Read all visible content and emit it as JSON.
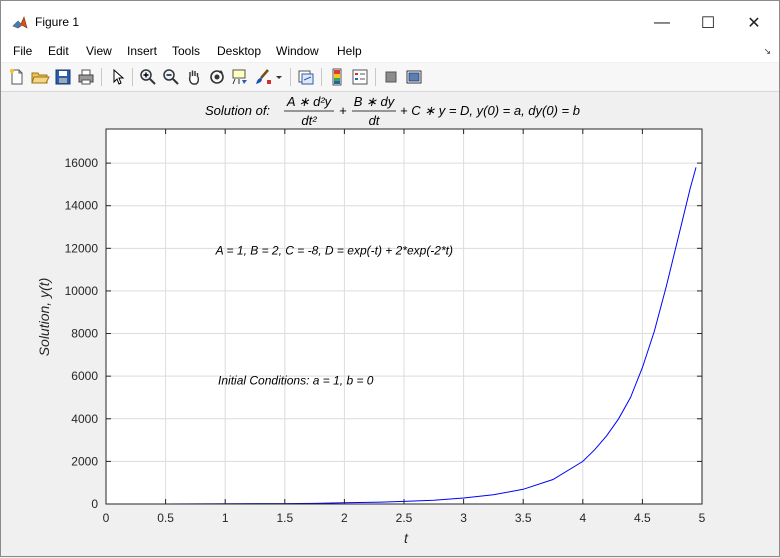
{
  "window": {
    "title": "Figure 1",
    "minimize_glyph": "—",
    "maximize_glyph": "☐",
    "close_glyph": "✕"
  },
  "menu": {
    "items": [
      "File",
      "Edit",
      "View",
      "Insert",
      "Tools",
      "Desktop",
      "Window",
      "Help"
    ],
    "overflow_glyph": "↘"
  },
  "toolbar": {
    "icons": [
      "new-figure-icon",
      "open-file-icon",
      "save-icon",
      "print-icon",
      "pointer-icon",
      "zoom-in-icon",
      "zoom-out-icon",
      "pan-hand-icon",
      "rotate-3d-icon",
      "data-cursor-icon",
      "brush-icon",
      "dropdown-arrow-icon",
      "link-plot-icon",
      "colorbar-icon",
      "legend-icon",
      "hide-plot-tools-icon",
      "show-plot-tools-icon"
    ]
  },
  "colors": {
    "series_line": "#0000ff",
    "grid": "#dcdcdc",
    "axes": "#262626",
    "menu_bg": "#ffffff",
    "figure_bg": "#f0f0f0"
  },
  "chart_data": {
    "type": "line",
    "title_prefix": "Solution of:",
    "title": "A*d²y/dt² + B*dy/dt + C*y = D, y(0) = a, dy(0) = b",
    "title_parts": {
      "frac1_num": "A ∗ d²y",
      "frac1_den": "dt²",
      "plus": "+",
      "frac2_num": "B ∗ dy",
      "frac2_den": "dt",
      "tail": "+ C ∗ y = D, y(0) = a, dy(0) = b"
    },
    "xlabel": "t",
    "ylabel": "Solution, y(t)",
    "xlim": [
      0,
      5
    ],
    "ylim": [
      0,
      17600
    ],
    "xticks": [
      0,
      0.5,
      1,
      1.5,
      2,
      2.5,
      3,
      3.5,
      4,
      4.5,
      5
    ],
    "xtick_labels": [
      "0",
      "0.5",
      "1",
      "1.5",
      "2",
      "2.5",
      "3",
      "3.5",
      "4",
      "4.5",
      "5"
    ],
    "yticks": [
      0,
      2000,
      4000,
      6000,
      8000,
      10000,
      12000,
      14000,
      16000
    ],
    "ytick_labels": [
      "0",
      "2000",
      "4000",
      "6000",
      "8000",
      "10000",
      "12000",
      "14000",
      "16000"
    ],
    "grid": true,
    "annotations": [
      {
        "text": "A = 1, B = 2, C = -8, D = exp(-t) + 2*exp(-2*t)",
        "x": 0.92,
        "y": 11700
      },
      {
        "text": "Initial Conditions: a = 1, b = 0",
        "x": 0.94,
        "y": 5600
      }
    ],
    "series": [
      {
        "x": [
          0,
          0.25,
          0.5,
          0.75,
          1.0,
          1.25,
          1.5,
          1.75,
          2.0,
          2.25,
          2.5,
          2.75,
          3.0,
          3.25,
          3.5,
          3.75,
          4.0,
          4.1,
          4.2,
          4.3,
          4.4,
          4.5,
          4.6,
          4.7,
          4.8,
          4.9,
          4.95
        ],
        "y": [
          0,
          0.4,
          2,
          4,
          9,
          17,
          20,
          30,
          55,
          80,
          120,
          180,
          280,
          430,
          690,
          1150,
          2000,
          2550,
          3200,
          4000,
          5000,
          6400,
          8100,
          10200,
          12500,
          14800,
          15800
        ]
      }
    ]
  }
}
